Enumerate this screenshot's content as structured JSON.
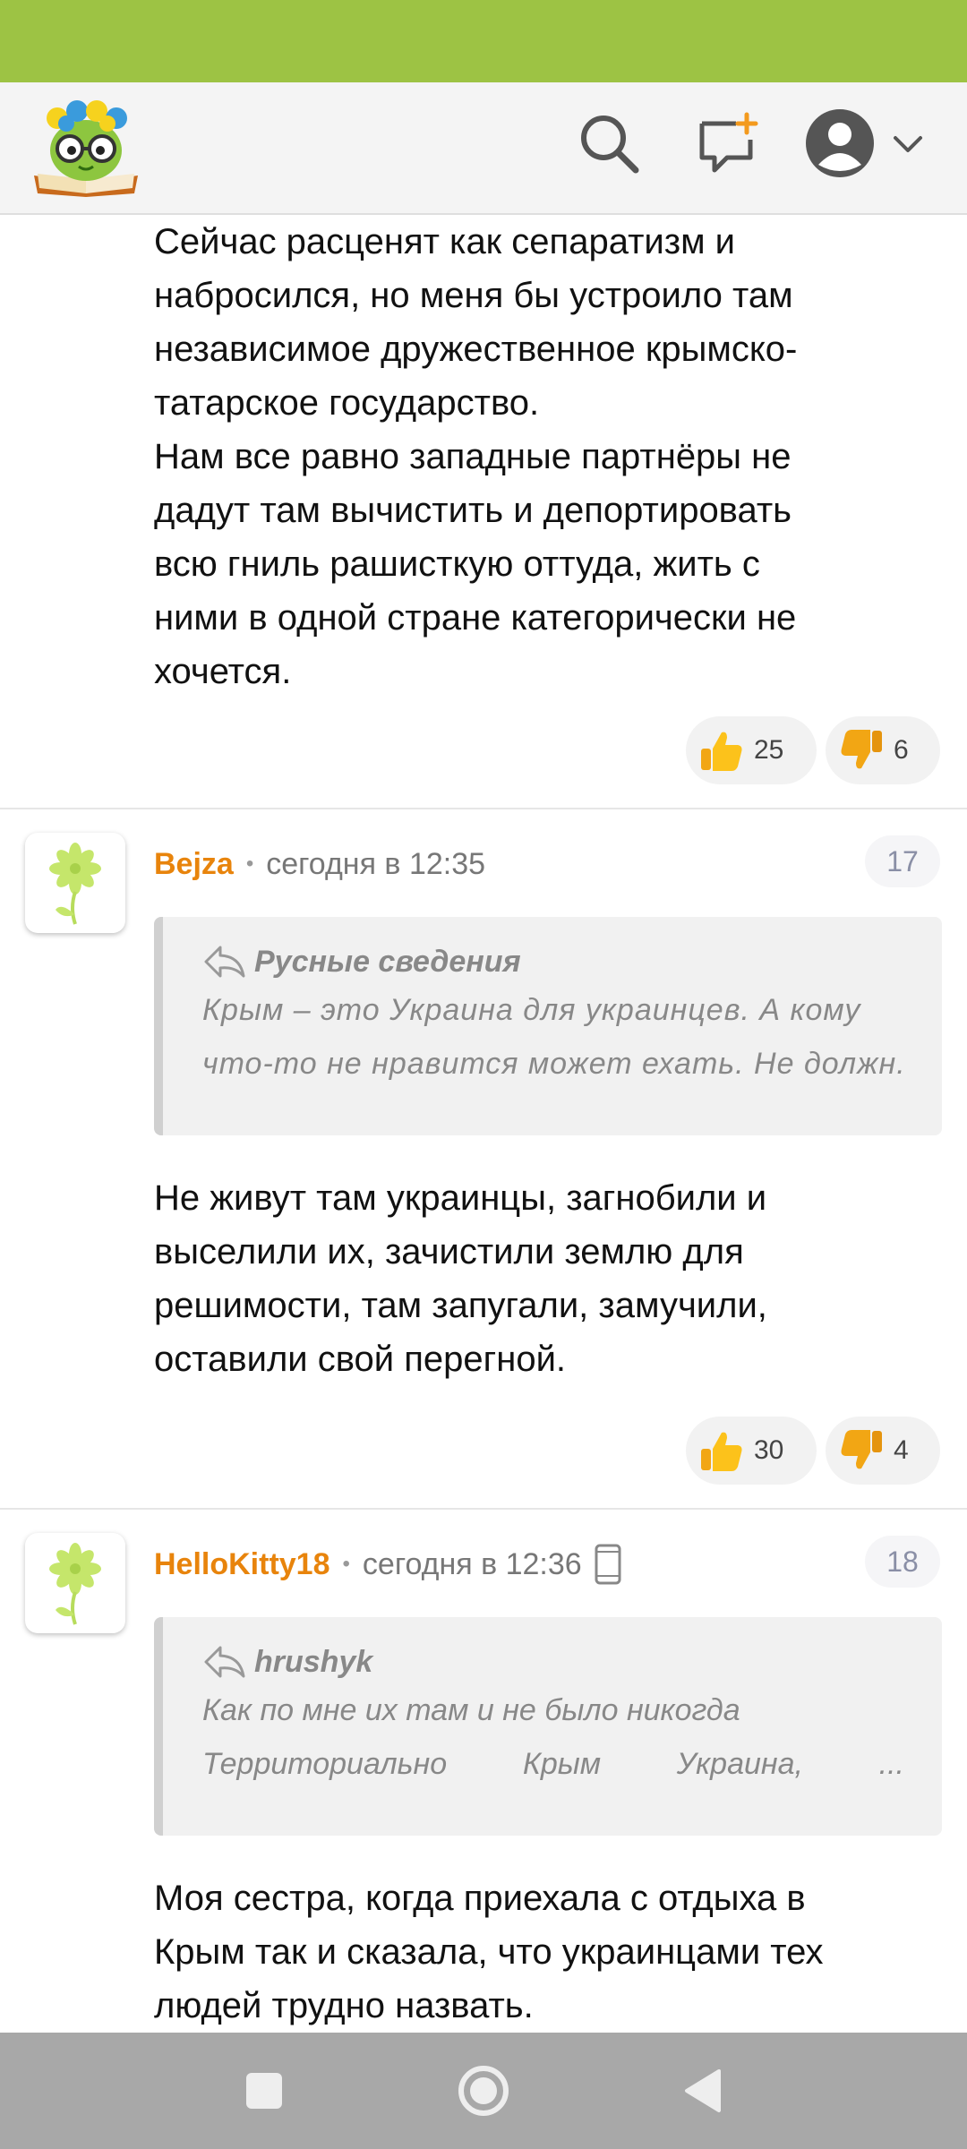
{
  "header": {
    "logo_name": "site-logo",
    "icons": [
      "search-icon",
      "new-post-icon",
      "avatar-icon",
      "chevron-down-icon"
    ]
  },
  "first_comment": {
    "text": "Сейчас расценят как сепаратизм и\nнабросился, но меня бы устроило там\nнезависимое дружественное крымско-\nтатарское государство.\nНам все равно западные партнёры не\nдадут там вычистить и депортировать\nвсю гниль рашисткую оттуда, жить с\nними в одной стране категорически не\nхочется.",
    "likes": "25",
    "dislikes": "6"
  },
  "comments": [
    {
      "author": "Bejza",
      "time": "сегодня в 12:35",
      "number": "17",
      "quote_author": "Русные сведения",
      "quote_lines": [
        "Крым – это Украина для украинцев. А кому",
        "что-то не нравится может ехать. Не должн..."
      ],
      "text": "Не живут там украинцы, загнобили и\nвыселили их, зачистили землю для\nрешимости, там запугали, замучили,\nоставили свой перегной.",
      "likes": "30",
      "dislikes": "4"
    },
    {
      "author": "HelloKitty18",
      "time": "сегодня в 12:36",
      "number": "18",
      "quote_author": "hrushyk",
      "quote_lines": [
        "Как по мне их там и не было никогда"
      ],
      "quote_words": [
        "Территориально",
        "Крым",
        "Украина,",
        "..."
      ],
      "text": "Моя сестра, когда приехала с отдыха в\nКрым так и сказала, что украинцами тех\nлюдей трудно назвать."
    }
  ],
  "colors": {
    "status_bar": "#9dc344",
    "author": "#e8840c",
    "nav_bar": "#a8a8a8"
  }
}
